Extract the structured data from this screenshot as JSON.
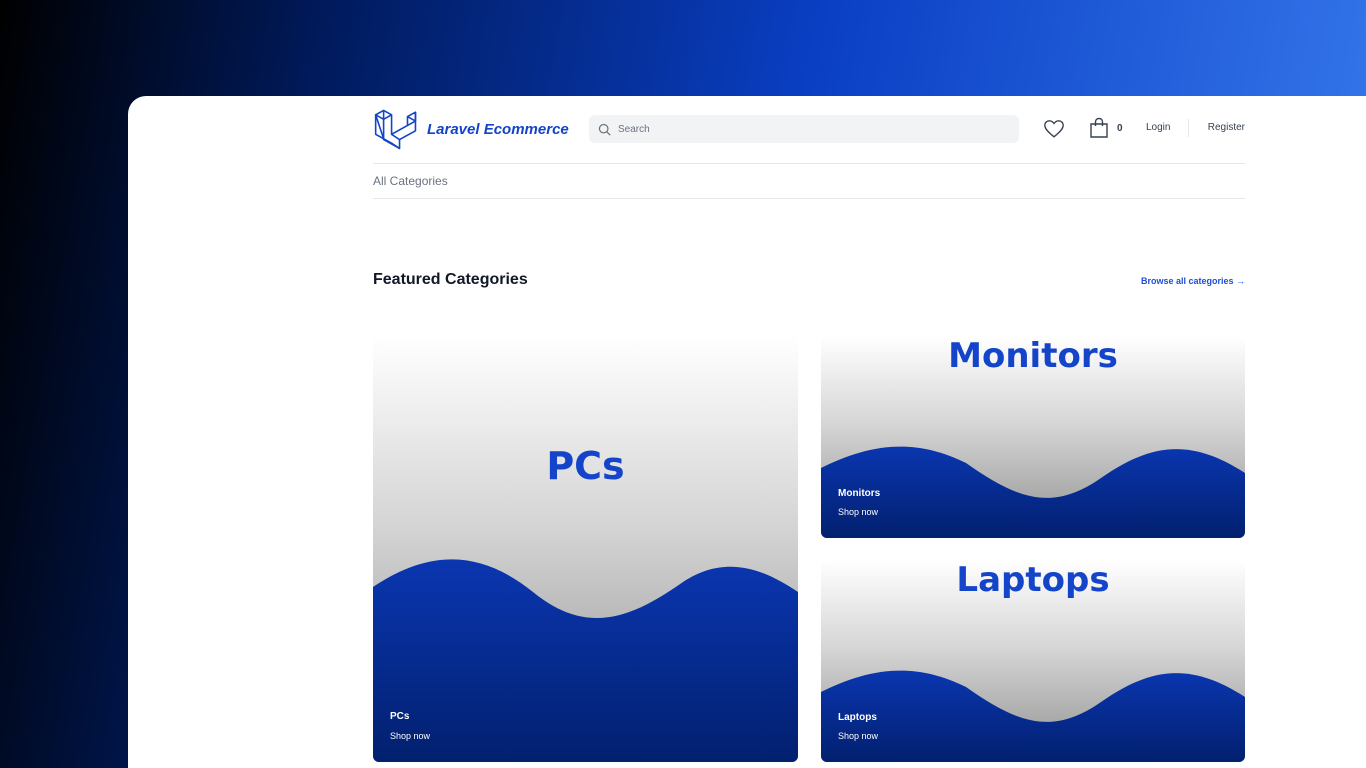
{
  "brand": {
    "name": "Laravel Ecommerce",
    "color": "#1344c9"
  },
  "search": {
    "placeholder": "Search"
  },
  "header": {
    "wishlist_icon": "heart-icon",
    "cart_icon": "shopping-bag-icon",
    "cart_count": "0",
    "login_label": "Login",
    "register_label": "Register"
  },
  "subnav": {
    "all_categories": "All Categories"
  },
  "featured": {
    "title": "Featured Categories",
    "browse_all": "Browse all categories →",
    "cards": [
      {
        "banner": "PCs",
        "name": "PCs",
        "cta": "Shop now"
      },
      {
        "banner": "Monitors",
        "name": "Monitors",
        "cta": "Shop now"
      },
      {
        "banner": "Laptops",
        "name": "Laptops",
        "cta": "Shop now"
      }
    ]
  },
  "colors": {
    "accent": "#1d4ed8",
    "wave": "#0b2fa0"
  }
}
